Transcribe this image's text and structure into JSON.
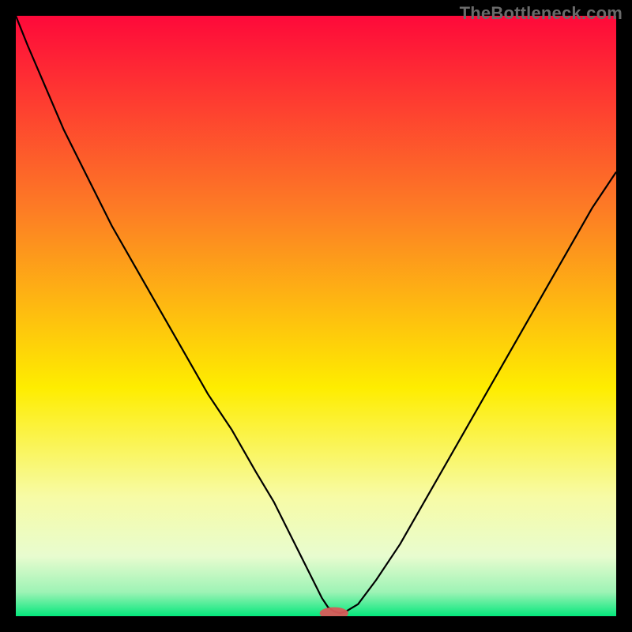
{
  "watermark": "TheBottleneck.com",
  "colors": {
    "gradient_top": "#fe093a",
    "gradient_mid1": "#fd7b25",
    "gradient_mid2": "#feed00",
    "gradient_mid3": "#f7fba5",
    "gradient_bottom": "#05e77c",
    "curve": "#000000",
    "marker": "#d85a58",
    "frame": "#000000"
  },
  "chart_data": {
    "type": "line",
    "title": "",
    "xlabel": "",
    "ylabel": "",
    "xlim": [
      0,
      100
    ],
    "ylim": [
      0,
      100
    ],
    "x": [
      0,
      2,
      5,
      8,
      12,
      16,
      20,
      24,
      28,
      32,
      36,
      40,
      43,
      46,
      48,
      50,
      51,
      52,
      53,
      54,
      55,
      57,
      60,
      64,
      68,
      72,
      76,
      80,
      84,
      88,
      92,
      96,
      100
    ],
    "values": [
      100,
      95,
      88,
      81,
      73,
      65,
      58,
      51,
      44,
      37,
      31,
      24,
      19,
      13,
      9,
      5,
      3,
      1.5,
      0.8,
      0.5,
      0.8,
      2,
      6,
      12,
      19,
      26,
      33,
      40,
      47,
      54,
      61,
      68,
      74
    ],
    "minimum_x": 53,
    "marker": {
      "cx": 53,
      "cy": 0.5,
      "rx": 2.4,
      "ry": 1.0
    },
    "annotations": []
  }
}
